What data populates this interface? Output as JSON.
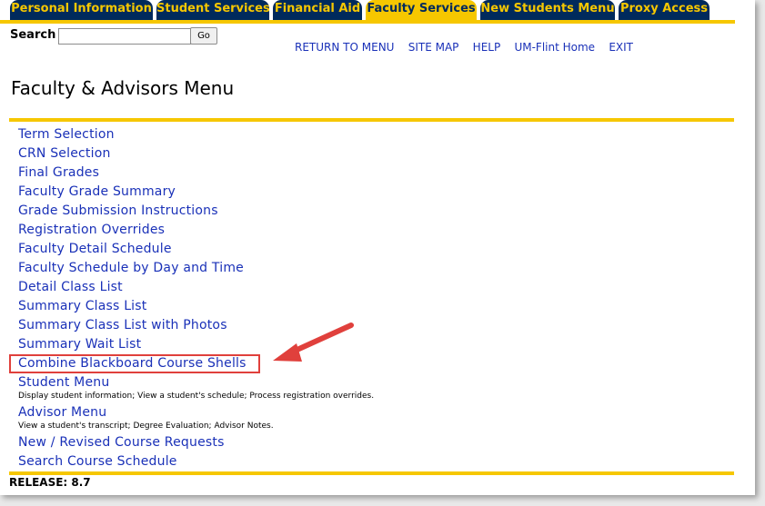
{
  "tabs": [
    {
      "label": "Personal Information",
      "active": false
    },
    {
      "label": "Student Services",
      "active": false
    },
    {
      "label": "Financial Aid",
      "active": false
    },
    {
      "label": "Faculty Services",
      "active": true
    },
    {
      "label": "New Students Menu",
      "active": false
    },
    {
      "label": "Proxy Access",
      "active": false
    }
  ],
  "search": {
    "label": "Search",
    "value": "",
    "go_label": "Go"
  },
  "toplinks": [
    "RETURN TO MENU",
    "SITE MAP",
    "HELP",
    "UM-Flint Home",
    "EXIT"
  ],
  "page_title": "Faculty & Advisors Menu",
  "menu": [
    {
      "label": "Term Selection"
    },
    {
      "label": "CRN Selection"
    },
    {
      "label": "Final Grades"
    },
    {
      "label": "Faculty Grade Summary"
    },
    {
      "label": "Grade Submission Instructions"
    },
    {
      "label": "Registration Overrides"
    },
    {
      "label": "Faculty Detail Schedule"
    },
    {
      "label": "Faculty Schedule by Day and Time"
    },
    {
      "label": "Detail Class List"
    },
    {
      "label": "Summary Class List"
    },
    {
      "label": "Summary Class List with Photos"
    },
    {
      "label": "Summary Wait List"
    },
    {
      "label": "Combine Blackboard Course Shells"
    },
    {
      "label": "Student Menu",
      "desc": "Display student information; View a student's schedule; Process registration overrides."
    },
    {
      "label": "Advisor Menu",
      "desc": "View a student's transcript; Degree Evaluation; Advisor Notes."
    },
    {
      "label": "New / Revised Course Requests"
    },
    {
      "label": "Search Course Schedule"
    }
  ],
  "release": "RELEASE: 8.7",
  "colors": {
    "navy": "#002a5c",
    "gold": "#f6c700",
    "link": "#1a31b8",
    "highlight": "#e0403c"
  }
}
